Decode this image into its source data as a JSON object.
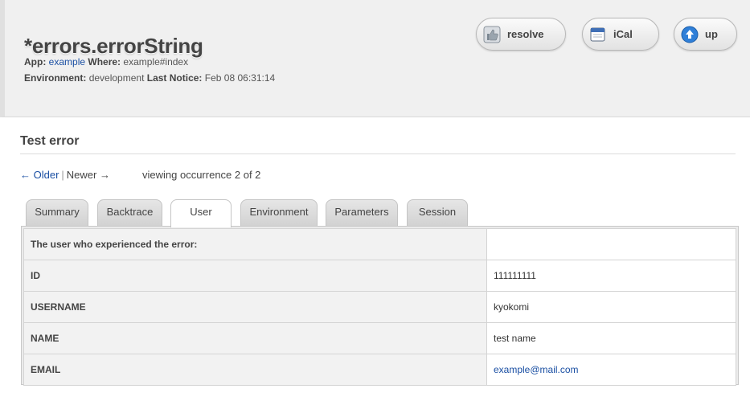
{
  "header": {
    "title": "*errors.errorString",
    "app_label": "App:",
    "app_value": "example",
    "where_label": "Where:",
    "where_value": "example#index",
    "env_label": "Environment:",
    "env_value": "development",
    "last_notice_label": "Last Notice:",
    "last_notice_value": "Feb 08 06:31:14",
    "buttons": {
      "resolve": "resolve",
      "ical": "iCal",
      "up": "up"
    }
  },
  "section_title": "Test error",
  "pager": {
    "older": "← Older",
    "separator": "|",
    "newer": "Newer →",
    "viewing": "viewing occurrence 2 of 2"
  },
  "tabs": [
    "Summary",
    "Backtrace",
    "User",
    "Environment",
    "Parameters",
    "Session"
  ],
  "active_tab": "User",
  "user_table": {
    "heading": "The user who experienced the error:",
    "rows": [
      {
        "label": "ID",
        "value": "111111111"
      },
      {
        "label": "USERNAME",
        "value": "kyokomi"
      },
      {
        "label": "NAME",
        "value": "test name"
      },
      {
        "label": "EMAIL",
        "value": "example@mail.com"
      }
    ]
  }
}
